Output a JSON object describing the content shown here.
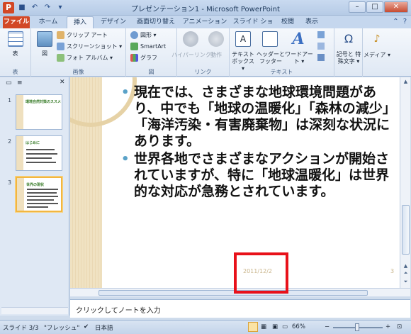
{
  "window": {
    "title": "プレゼンテーション1 - Microsoft PowerPoint"
  },
  "tabs": [
    "ファイル",
    "ホーム",
    "挿入",
    "デザイン",
    "画面切り替え",
    "アニメーション",
    "スライド ショー",
    "校閲",
    "表示"
  ],
  "ribbon": {
    "table": {
      "label": "表",
      "group": "表"
    },
    "images": {
      "picture": "図",
      "clipart": "クリップ アート",
      "screenshot": "スクリーンショット ▾",
      "photoalbum": "フォト アルバム ▾",
      "group": "画像"
    },
    "illustrations": {
      "shapes": "図形 ▾",
      "smartart": "SmartArt",
      "chart": "グラフ",
      "group": "図"
    },
    "links": {
      "hyperlink": "ハイパーリンク",
      "action": "動作",
      "group": "リンク"
    },
    "text": {
      "textbox": "テキスト ボックス ▾",
      "headerfooter": "ヘッダーと フッター",
      "wordart": "ワードアート ▾",
      "group": "テキスト"
    },
    "symbols": {
      "label": "記号と 特殊文字 ▾"
    },
    "media": {
      "label": "メディア ▾"
    }
  },
  "leftpane": {
    "slides": [
      {
        "num": "1",
        "title": "環境自然対策のススメ"
      },
      {
        "num": "2",
        "title": "はじめに"
      },
      {
        "num": "3",
        "title": "世界の現状"
      }
    ]
  },
  "slide": {
    "bullets": [
      "現在では、さまざまな地球環境問題があり、中でも「地球の温暖化」「森林の減少」「海洋汚染・有害廃棄物」は深刻な状況にあります。",
      "世界各地でさまざまなアクションが開始されていますが、特に「地球温暖化」は世界的な対応が急務とされています。"
    ],
    "date": "2011/12/2",
    "number": "3"
  },
  "notes": {
    "placeholder": "クリックしてノートを入力"
  },
  "statusbar": {
    "slide": "スライド 3/3",
    "theme": "\"フレッシュ\"",
    "language": "日本語",
    "zoom": "66%"
  }
}
